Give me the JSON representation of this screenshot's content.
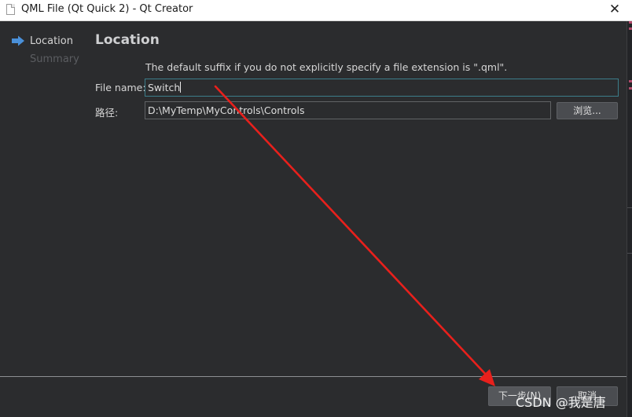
{
  "window": {
    "title": "QML File (Qt Quick 2) - Qt Creator",
    "close_glyph": "✕",
    "icon": "document-icon"
  },
  "sidebar": {
    "items": [
      {
        "label": "Location",
        "active": true,
        "icon": "arrow-right-icon"
      },
      {
        "label": "Summary",
        "active": false
      }
    ]
  },
  "main": {
    "title": "Location",
    "info": "The default suffix if you do not explicitly specify a file extension is \".qml\".",
    "file_name": {
      "label": "File name:",
      "value": "Switch"
    },
    "path": {
      "label": "路径:",
      "value": "D:\\MyTemp\\MyControls\\Controls"
    },
    "browse_label": "浏览..."
  },
  "footer": {
    "next_label": "下一步(N)",
    "cancel_label": "取消"
  },
  "watermark": "CSDN @我是唐",
  "colors": {
    "background": "#2b2c2e",
    "accent_arrow": "#4a90d9",
    "annotation_red": "#e8201c"
  }
}
